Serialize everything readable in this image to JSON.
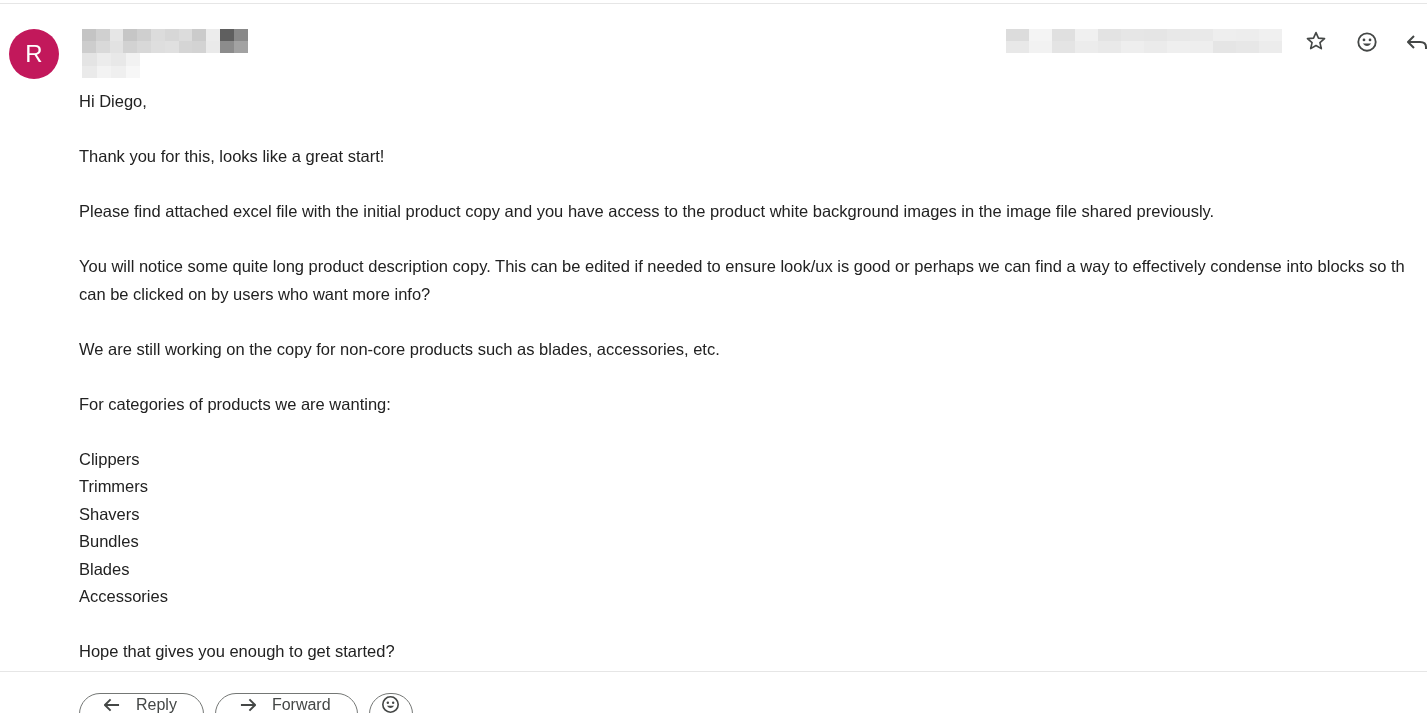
{
  "header": {
    "avatar_letter": "R",
    "starred": false
  },
  "body": [
    {
      "kind": "paragraph",
      "lines": [
        "Hi Diego,"
      ]
    },
    {
      "kind": "paragraph",
      "lines": [
        "Thank you for this, looks like a great start!"
      ]
    },
    {
      "kind": "paragraph",
      "lines": [
        "Please find attached excel file with the initial product copy and you have access to the product white background images in the image file shared previously."
      ]
    },
    {
      "kind": "paragraph",
      "lines": [
        "You will notice some quite long product description copy. This can be edited if needed to ensure look/ux is good or perhaps we can find a way to effectively condense into blocks so th",
        "can be clicked on by users who want more info?"
      ]
    },
    {
      "kind": "paragraph",
      "lines": [
        "We are still working on the copy for non-core products such as blades, accessories, etc."
      ]
    },
    {
      "kind": "paragraph",
      "lines": [
        "For categories of products we are wanting:"
      ]
    },
    {
      "kind": "list",
      "items": [
        "Clippers",
        "Trimmers",
        "Shavers",
        "Bundles",
        "Blades",
        "Accessories"
      ]
    },
    {
      "kind": "paragraph",
      "lines": [
        "Hope that gives you enough to get started?"
      ]
    }
  ],
  "actions": [
    {
      "kind": "reply",
      "label": "Reply"
    },
    {
      "kind": "forward",
      "label": "Forward"
    },
    {
      "kind": "emoji"
    }
  ]
}
